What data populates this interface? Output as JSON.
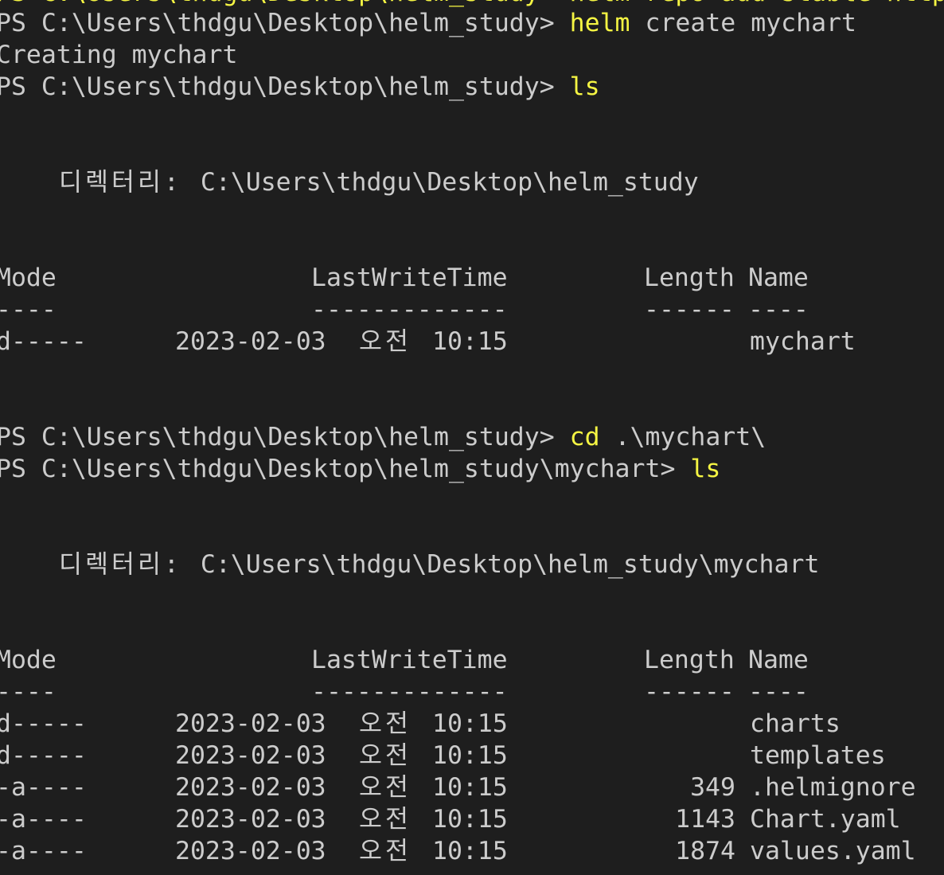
{
  "partial_top": "PS C:\\Users\\thdgu\\Desktop\\helm_study> helm repo add stable https://charts.helm.sh/stable",
  "prompt1": "PS C:\\Users\\thdgu\\Desktop\\helm_study> ",
  "cmd1": "helm",
  "args1": " create mychart",
  "out1": "Creating mychart",
  "prompt2": "PS C:\\Users\\thdgu\\Desktop\\helm_study> ",
  "cmd2": "ls",
  "dir1_label": "디렉터리: ",
  "dir1_path": "C:\\Users\\thdgu\\Desktop\\helm_study",
  "table_headers": {
    "mode": "Mode",
    "time": "LastWriteTime",
    "length": "Length",
    "name": "Name"
  },
  "table_sep": {
    "mode": "----",
    "time": "-------------",
    "length": "------",
    "name": "----"
  },
  "listing1": [
    {
      "mode": "d-----",
      "date": "2023-02-03",
      "ampm": "오전",
      "time": "10:15",
      "length": "",
      "name": "mychart"
    }
  ],
  "prompt3": "PS C:\\Users\\thdgu\\Desktop\\helm_study> ",
  "cmd3": "cd",
  "args3": " .\\mychart\\",
  "prompt4": "PS C:\\Users\\thdgu\\Desktop\\helm_study\\mychart> ",
  "cmd4": "ls",
  "dir2_label": "디렉터리: ",
  "dir2_path": "C:\\Users\\thdgu\\Desktop\\helm_study\\mychart",
  "listing2": [
    {
      "mode": "d-----",
      "date": "2023-02-03",
      "ampm": "오전",
      "time": "10:15",
      "length": "",
      "name": "charts"
    },
    {
      "mode": "d-----",
      "date": "2023-02-03",
      "ampm": "오전",
      "time": "10:15",
      "length": "",
      "name": "templates"
    },
    {
      "mode": "-a----",
      "date": "2023-02-03",
      "ampm": "오전",
      "time": "10:15",
      "length": "349",
      "name": ".helmignore"
    },
    {
      "mode": "-a----",
      "date": "2023-02-03",
      "ampm": "오전",
      "time": "10:15",
      "length": "1143",
      "name": "Chart.yaml"
    },
    {
      "mode": "-a----",
      "date": "2023-02-03",
      "ampm": "오전",
      "time": "10:15",
      "length": "1874",
      "name": "values.yaml"
    }
  ]
}
